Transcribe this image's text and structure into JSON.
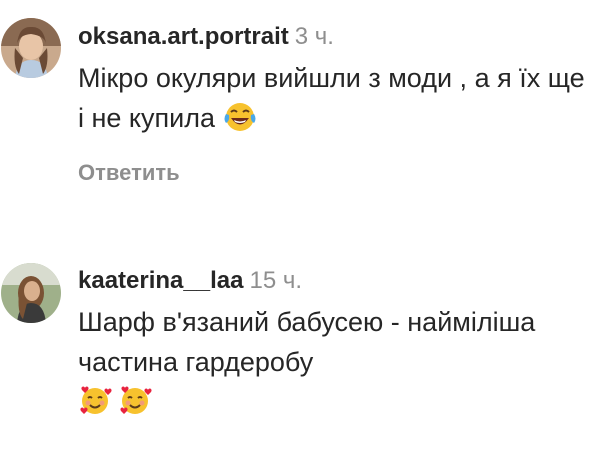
{
  "comments": [
    {
      "username": "oksana.art.portrait",
      "time": "3 ч.",
      "text": "Мікро окуляри вийшли з моди , а я їх ще і не купила",
      "emoji": "tears-of-joy-emoji",
      "reply_label": "Ответить",
      "avatar_color": "#b78a6b"
    },
    {
      "username": "kaaterina__laa",
      "time": "15 ч.",
      "text": "Шарф в'язаний бабусею - найміліша частина гардеробу",
      "emoji": [
        "smiling-face-with-hearts-emoji",
        "smiling-face-with-hearts-emoji"
      ],
      "avatar_color": "#8e7a5c"
    }
  ],
  "colors": {
    "text": "#262626",
    "secondary": "#8e8e8e",
    "emoji_yellow": "#f7c22e",
    "heart_red": "#e8233f"
  }
}
